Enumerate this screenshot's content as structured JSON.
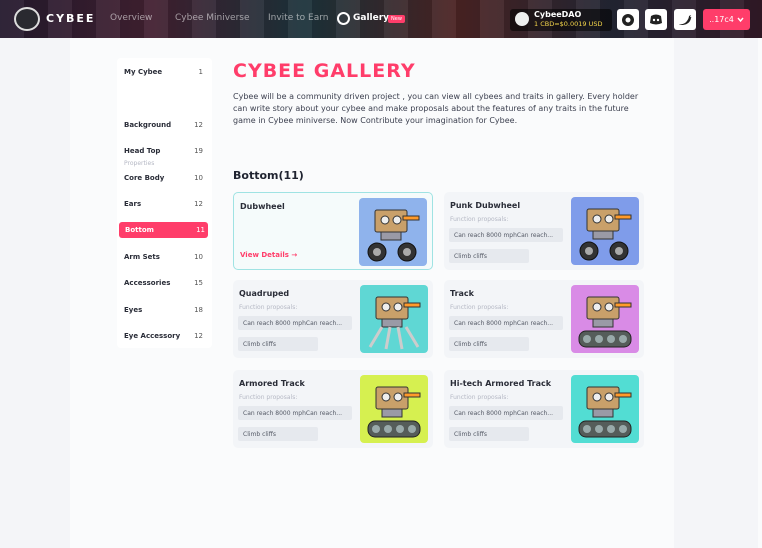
{
  "header": {
    "logo_text": "CYBEE",
    "nav": [
      "Overview",
      "Cybee Miniverse",
      "Invite to Earn",
      "Gallery"
    ],
    "new_badge": "New",
    "dao_name": "CybeeDAO",
    "dao_price": "1 CBD=$0.0019 USD",
    "wallet": "..17c4",
    "socials": [
      "coin-icon",
      "discord-icon",
      "twitter-icon"
    ]
  },
  "sidebar": {
    "my_cybee": {
      "label": "My Cybee",
      "count": "1"
    },
    "properties_label": "Properties",
    "items": [
      {
        "label": "Background",
        "count": "12"
      },
      {
        "label": "Head Top",
        "count": "19"
      },
      {
        "label": "Core Body",
        "count": "10"
      },
      {
        "label": "Ears",
        "count": "12"
      },
      {
        "label": "Bottom",
        "count": "11"
      },
      {
        "label": "Arm Sets",
        "count": "10"
      },
      {
        "label": "Accessories",
        "count": "15"
      },
      {
        "label": "Eyes",
        "count": "18"
      },
      {
        "label": "Eye Accessory",
        "count": "12"
      }
    ]
  },
  "main": {
    "title": "CYBEE GALLERY",
    "description": "Cybee will be a community driven project , you can view all cybees and traits in gallery. Every holder can write story about your cybee and make proposals about the features of any traits in the future game in Cybee miniverse. Now Contribute your imagination for Cybee.",
    "section_title": "Bottom(11)",
    "view_details": "View Details →",
    "func_label": "Function proposals:",
    "cards": [
      {
        "name": "Dubwheel",
        "chip1": "",
        "chip2": "",
        "bg": "#8fb3ec"
      },
      {
        "name": "Punk Dubwheel",
        "chip1": "Can reach 8000 mphCan reach...",
        "chip2": "Climb cliffs",
        "bg": "#7f9cea"
      },
      {
        "name": "Quadruped",
        "chip1": "Can reach 8000 mphCan reach...",
        "chip2": "Climb cliffs",
        "bg": "#5fd7d4"
      },
      {
        "name": "Track",
        "chip1": "Can reach 8000 mphCan reach...",
        "chip2": "Climb cliffs",
        "bg": "#d98be6"
      },
      {
        "name": "Armored Track",
        "chip1": "Can reach 8000 mphCan reach...",
        "chip2": "Climb cliffs",
        "bg": "#d6f050"
      },
      {
        "name": "Hi-tech Armored Track",
        "chip1": "Can reach 8000 mphCan reach...",
        "chip2": "Climb cliffs",
        "bg": "#52ddd3"
      }
    ]
  }
}
